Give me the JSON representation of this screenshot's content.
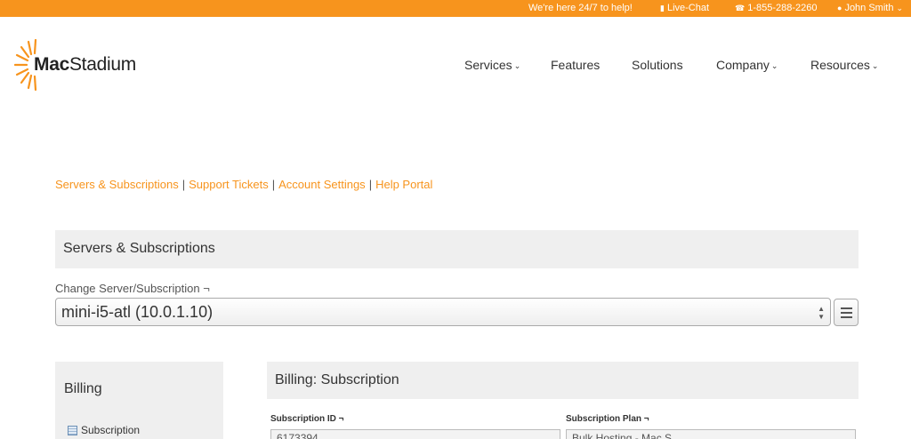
{
  "topbar": {
    "support_text": "We're here 24/7 to help!",
    "livechat_label": "Live-Chat",
    "phone": "1-855-288-2260",
    "user_name": "John Smith"
  },
  "brand": {
    "name_bold": "Mac",
    "name_rest": "Stadium"
  },
  "nav": {
    "services": "Services",
    "features": "Features",
    "solutions": "Solutions",
    "company": "Company",
    "resources": "Resources"
  },
  "crumbs": {
    "servers": "Servers & Subscriptions",
    "support": "Support Tickets",
    "account": "Account Settings",
    "help": "Help Portal",
    "separator": "|"
  },
  "section": {
    "title": "Servers & Subscriptions",
    "change_label": "Change Server/Subscription ¬",
    "selected_server": "mini-i5-atl (10.0.1.10)"
  },
  "sidebar": {
    "title": "Billing",
    "items": [
      {
        "label": "Subscription"
      }
    ]
  },
  "billing": {
    "title": "Billing: Subscription",
    "subscription_id_label": "Subscription ID ¬",
    "subscription_id_value": "6173394",
    "subscription_plan_label": "Subscription Plan ¬",
    "subscription_plan_value": "Bulk Hosting - Mac S..."
  },
  "icons": {
    "livechat": "chat-bubble-icon",
    "phone": "phone-icon",
    "user": "user-icon",
    "menu": "hamburger-menu-icon",
    "doc": "document-icon"
  },
  "colors": {
    "accent": "#f7941d",
    "panel": "#efefef"
  }
}
